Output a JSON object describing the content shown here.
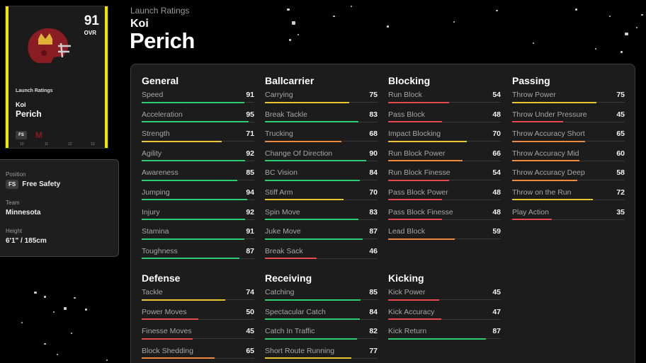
{
  "card": {
    "ovr": "91",
    "ovr_label": "OVR",
    "launch_label": "Launch Ratings",
    "first_name": "Koi",
    "last_name": "Perich",
    "position_badge": "FS",
    "card_ticks": [
      "10",
      "11",
      "12",
      "13"
    ]
  },
  "info": {
    "position_label": "Position",
    "position_badge": "FS",
    "position_value": "Free Safety",
    "team_label": "Team",
    "team_value": "Minnesota",
    "height_label": "Height",
    "height_value": "6'1\" / 185cm"
  },
  "header": {
    "subtitle": "Launch Ratings",
    "first_name": "Koi",
    "last_name": "Perich"
  },
  "colors": {
    "green": "#2ecc71",
    "yellow": "#e8c531",
    "orange": "#ef8a3b",
    "red": "#e5484d",
    "card_edge": "#f2e600"
  },
  "groups": [
    {
      "title": "General",
      "stats": [
        {
          "name": "Speed",
          "value": 91
        },
        {
          "name": "Acceleration",
          "value": 95
        },
        {
          "name": "Strength",
          "value": 71
        },
        {
          "name": "Agility",
          "value": 92
        },
        {
          "name": "Awareness",
          "value": 85
        },
        {
          "name": "Jumping",
          "value": 94
        },
        {
          "name": "Injury",
          "value": 92
        },
        {
          "name": "Stamina",
          "value": 91
        },
        {
          "name": "Toughness",
          "value": 87
        }
      ]
    },
    {
      "title": "Ballcarrier",
      "stats": [
        {
          "name": "Carrying",
          "value": 75
        },
        {
          "name": "Break Tackle",
          "value": 83
        },
        {
          "name": "Trucking",
          "value": 68
        },
        {
          "name": "Change Of Direction",
          "value": 90
        },
        {
          "name": "BC Vision",
          "value": 84
        },
        {
          "name": "Stiff Arm",
          "value": 70
        },
        {
          "name": "Spin Move",
          "value": 83
        },
        {
          "name": "Juke Move",
          "value": 87
        },
        {
          "name": "Break Sack",
          "value": 46
        }
      ]
    },
    {
      "title": "Blocking",
      "stats": [
        {
          "name": "Run Block",
          "value": 54
        },
        {
          "name": "Pass Block",
          "value": 48
        },
        {
          "name": "Impact Blocking",
          "value": 70
        },
        {
          "name": "Run Block Power",
          "value": 66
        },
        {
          "name": "Run Block Finesse",
          "value": 54
        },
        {
          "name": "Pass Block Power",
          "value": 48
        },
        {
          "name": "Pass Block Finesse",
          "value": 48
        },
        {
          "name": "Lead Block",
          "value": 59
        }
      ]
    },
    {
      "title": "Passing",
      "stats": [
        {
          "name": "Throw Power",
          "value": 75
        },
        {
          "name": "Throw Under Pressure",
          "value": 45
        },
        {
          "name": "Throw Accuracy Short",
          "value": 65
        },
        {
          "name": "Throw Accuracy Mid",
          "value": 60
        },
        {
          "name": "Throw Accuracy Deep",
          "value": 58
        },
        {
          "name": "Throw on the Run",
          "value": 72
        },
        {
          "name": "Play Action",
          "value": 35
        }
      ]
    },
    {
      "title": "Defense",
      "stats": [
        {
          "name": "Tackle",
          "value": 74
        },
        {
          "name": "Power Moves",
          "value": 50
        },
        {
          "name": "Finesse Moves",
          "value": 45
        },
        {
          "name": "Block Shedding",
          "value": 65
        }
      ]
    },
    {
      "title": "Receiving",
      "stats": [
        {
          "name": "Catching",
          "value": 85
        },
        {
          "name": "Spectacular Catch",
          "value": 84
        },
        {
          "name": "Catch In Traffic",
          "value": 82
        },
        {
          "name": "Short Route Running",
          "value": 77
        }
      ]
    },
    {
      "title": "Kicking",
      "stats": [
        {
          "name": "Kick Power",
          "value": 45
        },
        {
          "name": "Kick Accuracy",
          "value": 47
        },
        {
          "name": "Kick Return",
          "value": 87
        }
      ]
    }
  ]
}
